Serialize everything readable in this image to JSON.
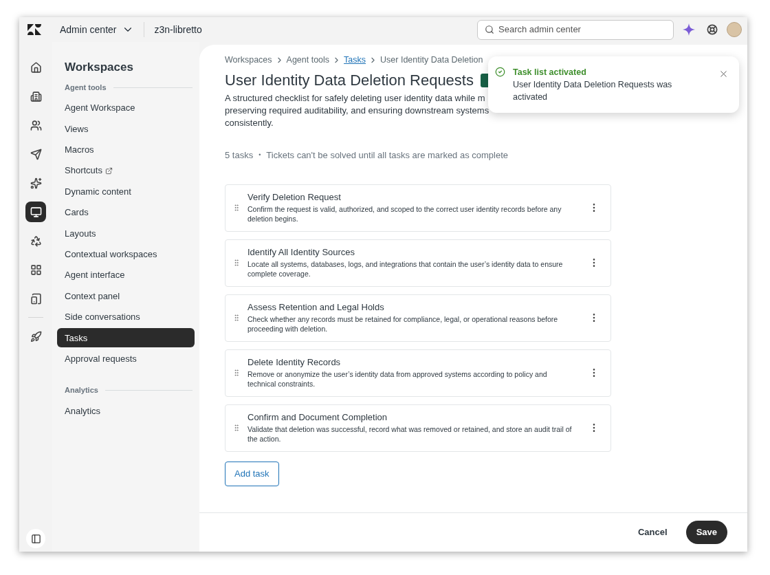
{
  "topbar": {
    "product": "Admin center",
    "account": "z3n-libretto",
    "search": {
      "placeholder": "Search admin center"
    }
  },
  "rail": [
    {
      "selected": false
    },
    {
      "selected": false
    },
    {
      "selected": false
    },
    {
      "selected": false
    },
    {
      "selected": false
    },
    {
      "selected": true
    },
    {
      "selected": false
    },
    {
      "selected": false
    },
    {
      "selected": false
    },
    {
      "selected": false
    }
  ],
  "sidebar": {
    "title": "Workspaces",
    "sections": [
      {
        "heading": "Agent tools",
        "items": [
          {
            "label": "Agent Workspace",
            "selected": false,
            "external": false
          },
          {
            "label": "Views",
            "selected": false,
            "external": false
          },
          {
            "label": "Macros",
            "selected": false,
            "external": false
          },
          {
            "label": "Shortcuts",
            "selected": false,
            "external": true
          },
          {
            "label": "Dynamic content",
            "selected": false,
            "external": false
          },
          {
            "label": "Cards",
            "selected": false,
            "external": false
          },
          {
            "label": "Layouts",
            "selected": false,
            "external": false
          },
          {
            "label": "Contextual workspaces",
            "selected": false,
            "external": false
          },
          {
            "label": "Agent interface",
            "selected": false,
            "external": false
          },
          {
            "label": "Context panel",
            "selected": false,
            "external": false
          },
          {
            "label": "Side conversations",
            "selected": false,
            "external": false
          },
          {
            "label": "Tasks",
            "selected": true,
            "external": false
          },
          {
            "label": "Approval requests",
            "selected": false,
            "external": false
          }
        ]
      },
      {
        "heading": "Analytics",
        "items": [
          {
            "label": "Analytics",
            "selected": false,
            "external": false
          }
        ]
      }
    ]
  },
  "breadcrumb": [
    {
      "label": "Workspaces",
      "link": false
    },
    {
      "label": "Agent tools",
      "link": false
    },
    {
      "label": "Tasks",
      "link": true
    },
    {
      "label": "User Identity Data Deletion",
      "link": false
    }
  ],
  "title": "User Identity Data Deletion Requests",
  "description_lines": [
    "A structured checklist for safely deleting user identity data while m",
    "preserving required auditability, and ensuring downstream systems",
    "consistently."
  ],
  "summary": {
    "count": "5 tasks",
    "separator": "•",
    "note": "Tickets can't be solved until all tasks are marked as complete"
  },
  "tasks": [
    {
      "title": "Verify Deletion Request",
      "description": "Confirm the request is valid, authorized, and scoped to the correct user identity records before any deletion begins."
    },
    {
      "title": "Identify All Identity Sources",
      "description": "Locate all systems, databases, logs, and integrations that contain the user’s identity data to ensure complete coverage."
    },
    {
      "title": "Assess Retention and Legal Holds",
      "description": "Check whether any records must be retained for compliance, legal, or operational reasons before proceeding with deletion."
    },
    {
      "title": "Delete Identity Records",
      "description": "Remove or anonymize the user’s identity data from approved systems according to policy and technical constraints."
    },
    {
      "title": "Confirm and Document Completion",
      "description": "Validate that deletion was successful, record what was removed or retained, and store an audit trail of the action."
    }
  ],
  "add_button": "Add task",
  "footer": {
    "cancel": "Cancel",
    "save": "Save"
  },
  "toast": {
    "title": "Task list activated",
    "message": "User Identity Data Deletion Requests was activated"
  }
}
